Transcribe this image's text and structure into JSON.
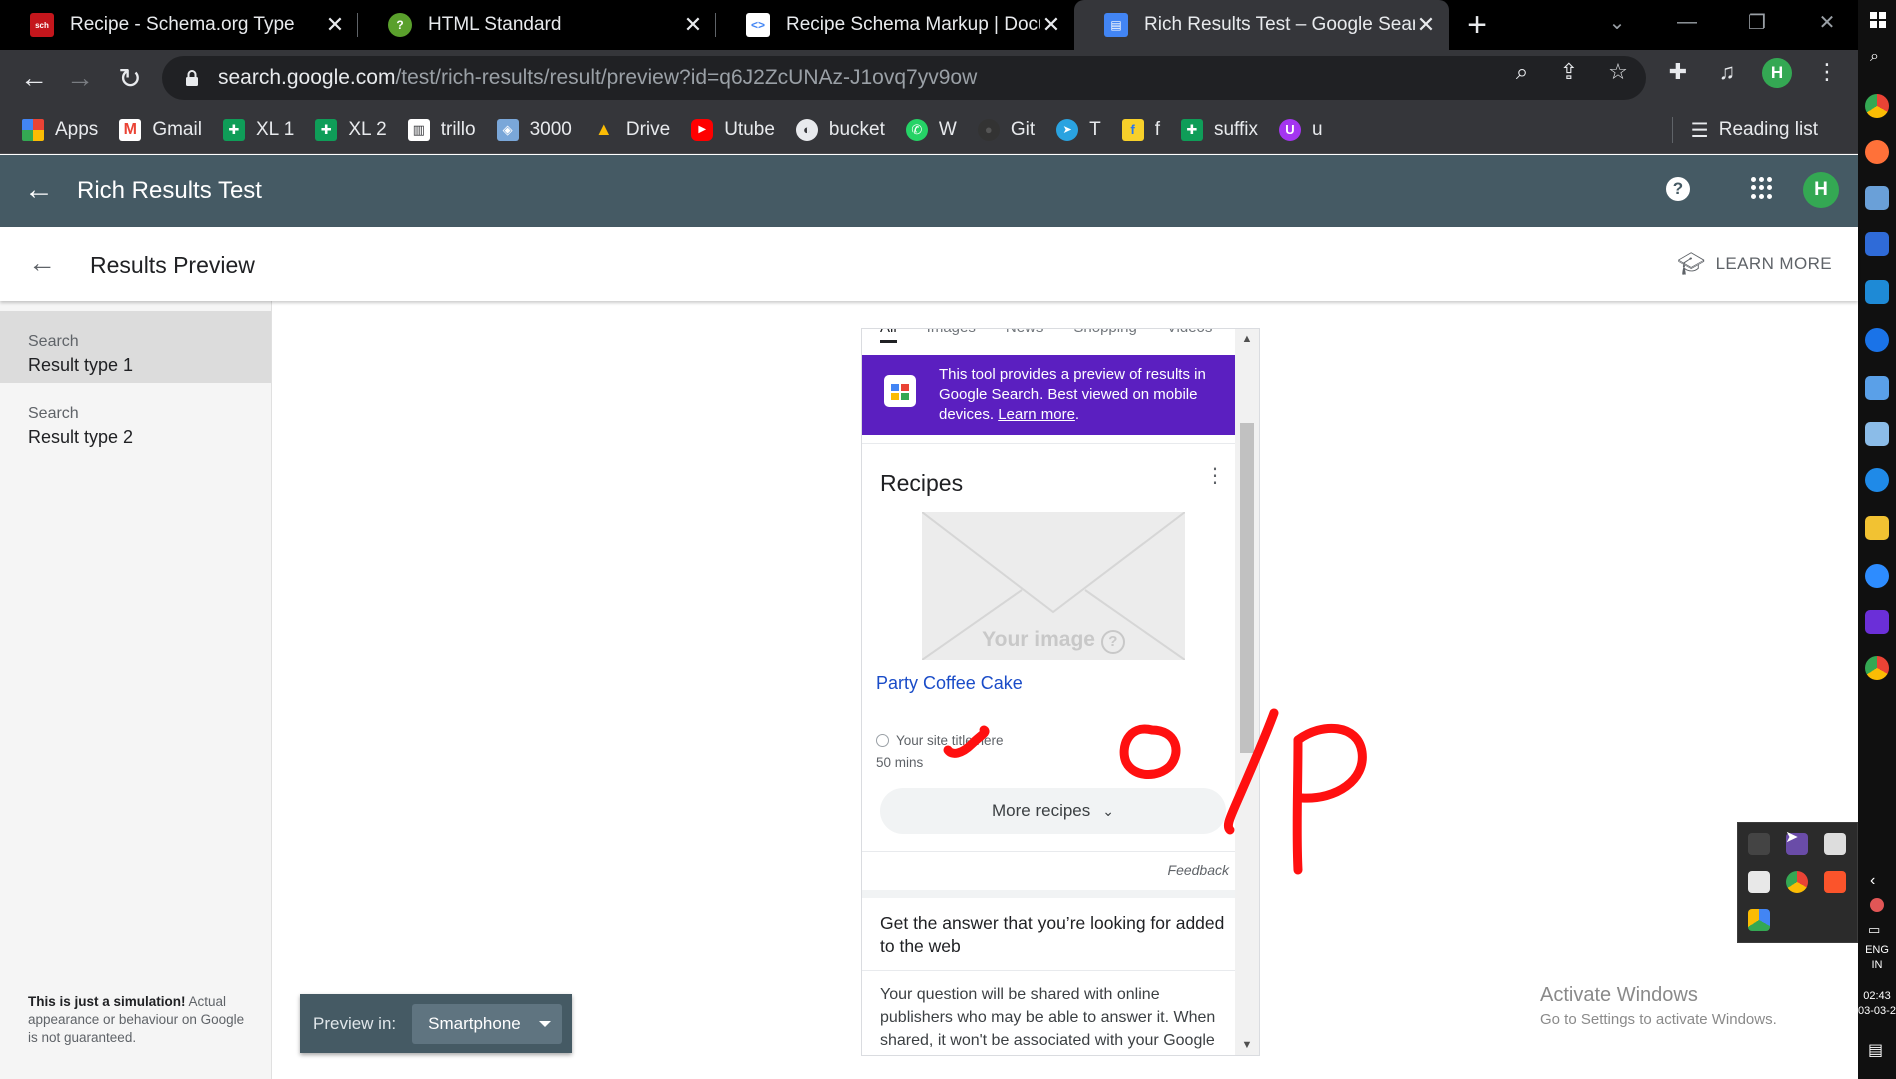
{
  "browser": {
    "tabs": [
      {
        "title": "Recipe - Schema.org Type",
        "icon": "schema-org-icon",
        "color": "#c4161c"
      },
      {
        "title": "HTML Standard",
        "icon": "whatwg-icon",
        "color": "#5aa02c"
      },
      {
        "title": "Recipe Schema Markup  |  Docum",
        "icon": "google-developers-icon",
        "color": "#ffffff"
      },
      {
        "title": "Rich Results Test – Google Search",
        "icon": "google-search-console-icon",
        "color": "#4285f4",
        "active": true
      }
    ],
    "url_host": "search.google.com",
    "url_path": "/test/rich-results/result/preview?id=q6J2ZcUNAz-J1ovq7yv9ow",
    "profile_initial": "H",
    "bookmarks": [
      {
        "label": "Apps",
        "icon": "apps-grid-icon",
        "color": "#ea4335"
      },
      {
        "label": "Gmail",
        "icon": "gmail-icon",
        "color": "#ea4335"
      },
      {
        "label": "XL 1",
        "icon": "google-sheets-icon",
        "color": "#0f9d58"
      },
      {
        "label": "XL 2",
        "icon": "google-sheets-icon",
        "color": "#0f9d58"
      },
      {
        "label": "trillo",
        "icon": "trello-icon",
        "color": "#ffffff"
      },
      {
        "label": "3000",
        "icon": "bookmark-icon",
        "color": "#7aa7d9"
      },
      {
        "label": "Drive",
        "icon": "google-drive-icon",
        "color": "#fbbc04"
      },
      {
        "label": "Utube",
        "icon": "youtube-icon",
        "color": "#ff0000"
      },
      {
        "label": "bucket",
        "icon": "globe-icon",
        "color": "#e8eaed"
      },
      {
        "label": "W",
        "icon": "whatsapp-icon",
        "color": "#25d366"
      },
      {
        "label": "Git",
        "icon": "github-icon",
        "color": "#333333"
      },
      {
        "label": "T",
        "icon": "telegram-icon",
        "color": "#2aa3e0"
      },
      {
        "label": "f",
        "icon": "flipkart-icon",
        "color": "#f7d02a"
      },
      {
        "label": "suffix",
        "icon": "google-sheets-icon",
        "color": "#0f9d58"
      },
      {
        "label": "u",
        "icon": "udemy-icon",
        "color": "#a435f0"
      }
    ],
    "reading_list": "Reading list"
  },
  "app": {
    "title": "Rich Results Test",
    "subheader_title": "Results Preview",
    "learn_more": "LEARN MORE",
    "help_glyph": "?",
    "account_initial": "H"
  },
  "sidebar": {
    "items": [
      {
        "kind": "Search",
        "label": "Result type 1",
        "selected": true
      },
      {
        "kind": "Search",
        "label": "Result type 2",
        "selected": false
      }
    ],
    "disclaimer_bold": "This is just a simulation!",
    "disclaimer_rest": " Actual appearance or behaviour on Google is not guaranteed."
  },
  "preview": {
    "search_tabs": [
      "All",
      "Images",
      "News",
      "Shopping",
      "Videos"
    ],
    "banner_text": "This tool provides a preview of results in Google Search. Best viewed on mobile devices.",
    "banner_link": "Learn more",
    "banner_link_suffix": ".",
    "card_title": "Recipes",
    "image_placeholder": "Your image",
    "recipe_name": "Party Coffee Cake",
    "site_title": "Your site title here",
    "cook_time": "50 mins",
    "more_button": "More recipes",
    "feedback": "Feedback",
    "question_title": "Get the answer that you’re looking for added to the web",
    "question_body": "Your question will be shared with online publishers who may be able to answer it. When shared, it won't be associated with your Google"
  },
  "preview_in": {
    "label": "Preview in:",
    "value": "Smartphone"
  },
  "watermark": {
    "line1": "Activate Windows",
    "line2": "Go to Settings to activate Windows."
  },
  "taskbar": {
    "lang1": "ENG",
    "lang2": "IN",
    "time": "02:43",
    "date": "03-03-2"
  },
  "annotation": {
    "color": "#ff0000",
    "note": "o/p"
  }
}
